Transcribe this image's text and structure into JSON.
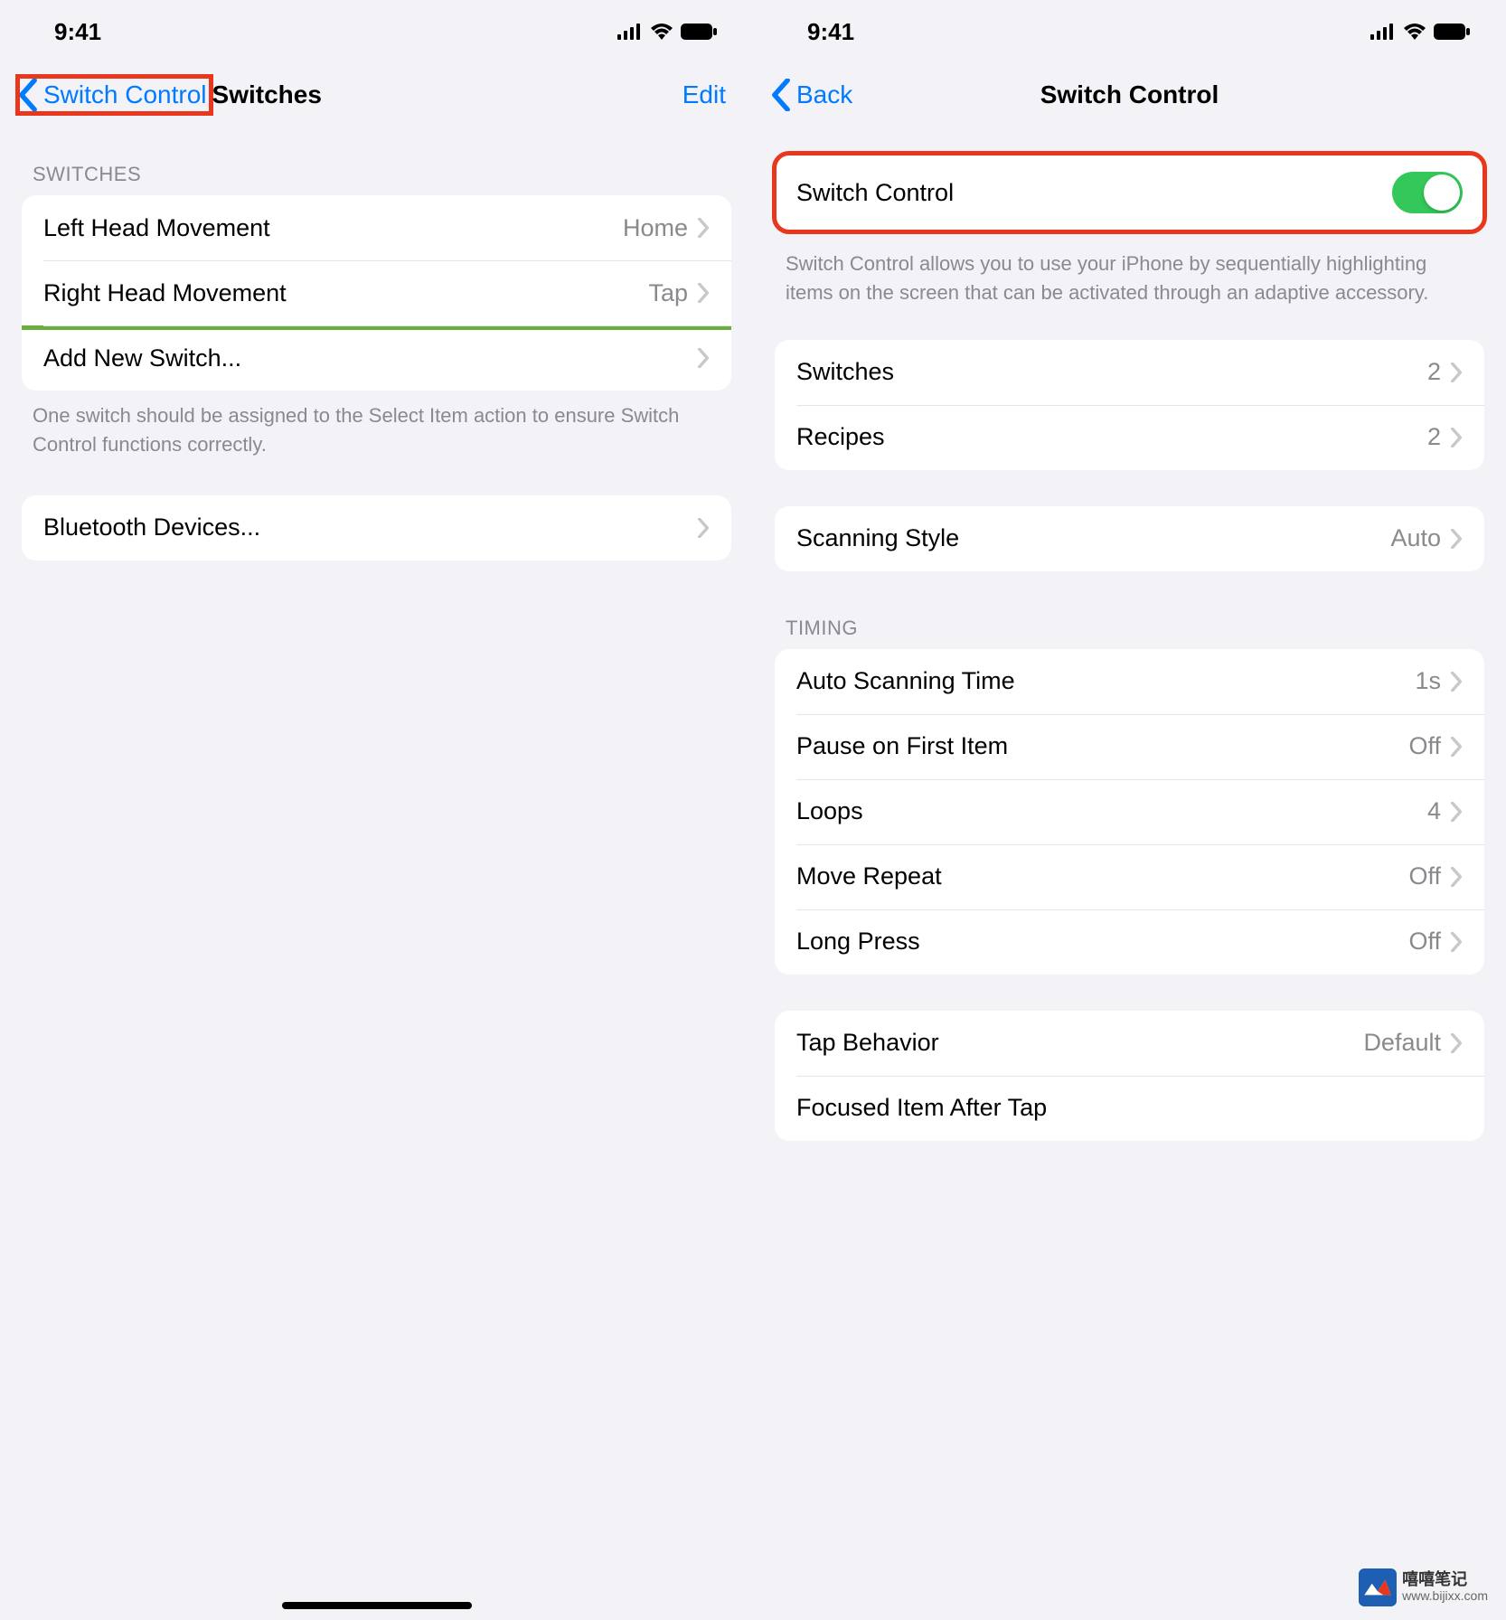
{
  "status": {
    "time": "9:41"
  },
  "left": {
    "nav": {
      "back": "Switch Control",
      "title": "Switches",
      "edit": "Edit"
    },
    "section_header": "SWITCHES",
    "switches": [
      {
        "label": "Left Head Movement",
        "value": "Home"
      },
      {
        "label": "Right Head Movement",
        "value": "Tap"
      }
    ],
    "add_new": "Add New Switch...",
    "footer": "One switch should be assigned to the Select Item action to ensure Switch Control functions correctly.",
    "bluetooth": "Bluetooth Devices..."
  },
  "right": {
    "nav": {
      "back": "Back",
      "title": "Switch Control"
    },
    "toggle_row": {
      "label": "Switch Control"
    },
    "toggle_footer": "Switch Control allows you to use your iPhone by sequentially highlighting items on the screen that can be activated through an adaptive accessory.",
    "group2": [
      {
        "label": "Switches",
        "value": "2"
      },
      {
        "label": "Recipes",
        "value": "2"
      }
    ],
    "scanning": {
      "label": "Scanning Style",
      "value": "Auto"
    },
    "timing_header": "TIMING",
    "timing": [
      {
        "label": "Auto Scanning Time",
        "value": "1s"
      },
      {
        "label": "Pause on First Item",
        "value": "Off"
      },
      {
        "label": "Loops",
        "value": "4"
      },
      {
        "label": "Move Repeat",
        "value": "Off"
      },
      {
        "label": "Long Press",
        "value": "Off"
      }
    ],
    "tap_group": [
      {
        "label": "Tap Behavior",
        "value": "Default"
      },
      {
        "label": "Focused Item After Tap",
        "value": ""
      }
    ]
  },
  "watermark": {
    "cn": "嘻嘻笔记",
    "url": "www.bijixx.com"
  }
}
